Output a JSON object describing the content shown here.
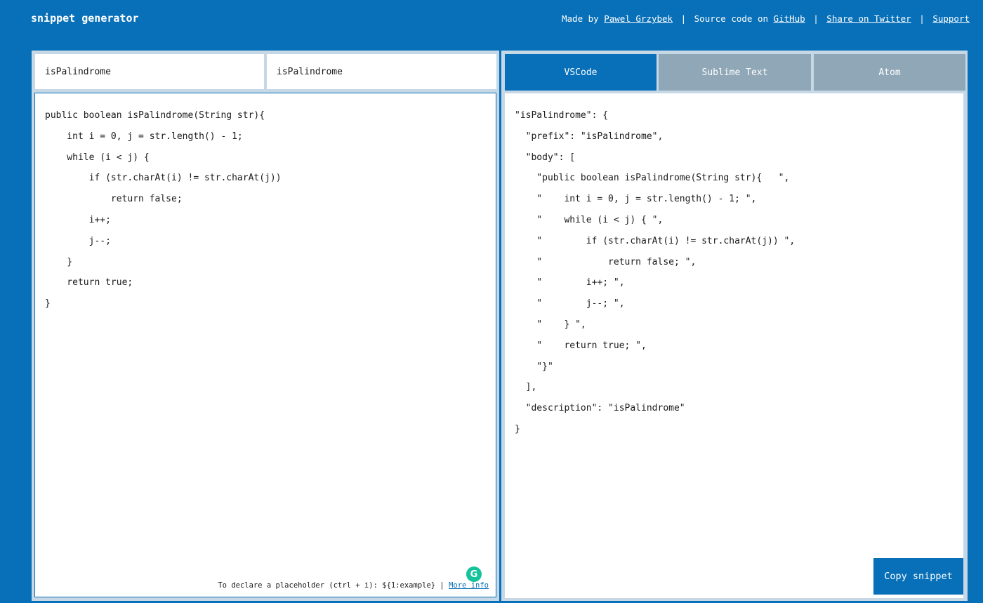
{
  "header": {
    "title": "snippet generator",
    "made_by_text": "Made by",
    "author_link": "Pawel Grzybek",
    "source_text": "Source code on",
    "github_link": "GitHub",
    "twitter_link": "Share on Twitter",
    "support_link": "Support",
    "separator": "|"
  },
  "inputs": {
    "description_value": "isPalindrome",
    "tab_trigger_value": "isPalindrome"
  },
  "editor": {
    "code": "public boolean isPalindrome(String str){\n    int i = 0, j = str.length() - 1;\n    while (i < j) {\n        if (str.charAt(i) != str.charAt(j))\n            return false;\n        i++;\n        j--;\n    }\n    return true;\n}",
    "hint_text": "To declare a placeholder (ctrl + i): ${1:example} |",
    "hint_link": "More info",
    "grammarly_glyph": "G"
  },
  "tabs": [
    {
      "label": "VSCode",
      "active": true
    },
    {
      "label": "Sublime Text",
      "active": false
    },
    {
      "label": "Atom",
      "active": false
    }
  ],
  "output": {
    "code": "\"isPalindrome\": {\n  \"prefix\": \"isPalindrome\",\n  \"body\": [\n    \"public boolean isPalindrome(String str){   \",\n    \"    int i = 0, j = str.length() - 1; \",\n    \"    while (i < j) { \",\n    \"        if (str.charAt(i) != str.charAt(j)) \",\n    \"            return false; \",\n    \"        i++; \",\n    \"        j--; \",\n    \"    } \",\n    \"    return true; \",\n    \"}\"\n  ],\n  \"description\": \"isPalindrome\"\n}",
    "copy_label": "Copy snippet"
  },
  "colors": {
    "background": "#0870b8",
    "panel": "#c6d7e6",
    "tab_inactive": "#8fa7b6",
    "grammarly": "#15c39a"
  }
}
